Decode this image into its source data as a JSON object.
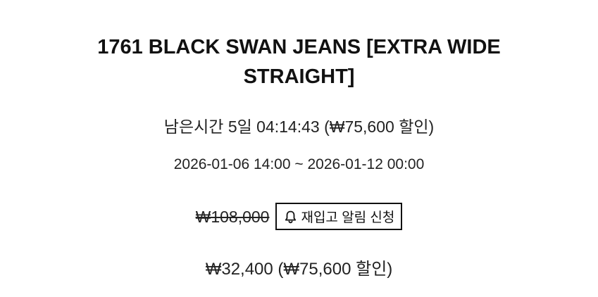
{
  "product": {
    "title": "1761 BLACK SWAN JEANS [EXTRA WIDE STRAIGHT]",
    "countdown_text": "남은시간 5일 04:14:43 (₩75,600 할인)",
    "sale_period": "2026-01-06 14:00 ~ 2026-01-12 00:00",
    "original_price": "₩108,000",
    "restock_alert_label": "재입고 알림 신청",
    "restock_alert_icon": "bell-icon",
    "sale_price_text": "₩32,400 (₩75,600 할인)"
  }
}
